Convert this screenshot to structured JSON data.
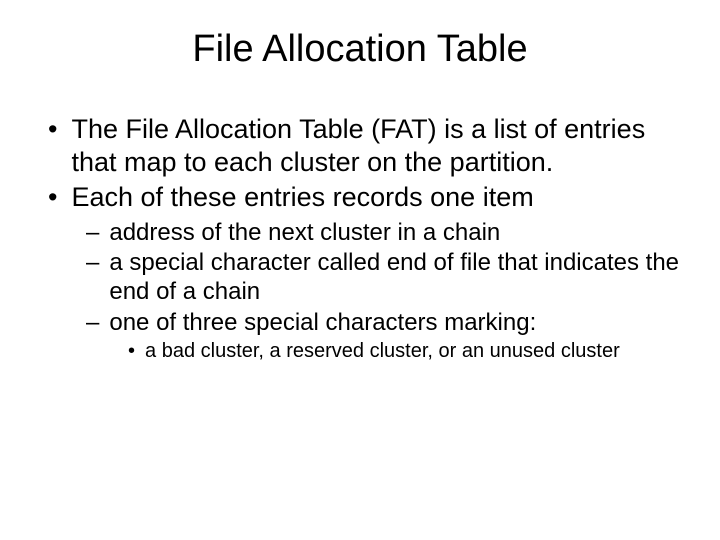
{
  "title": "File Allocation Table",
  "bullets": {
    "b1": "The File Allocation Table (FAT) is a list of entries that map to each cluster on the partition.",
    "b2": "Each of these entries records one item",
    "s1": "address of the next cluster in a chain",
    "s2": "a special character called end of file that indicates the end of a chain",
    "s3": "one of three special characters marking:",
    "ss1": "a bad cluster, a reserved cluster, or an unused cluster"
  }
}
